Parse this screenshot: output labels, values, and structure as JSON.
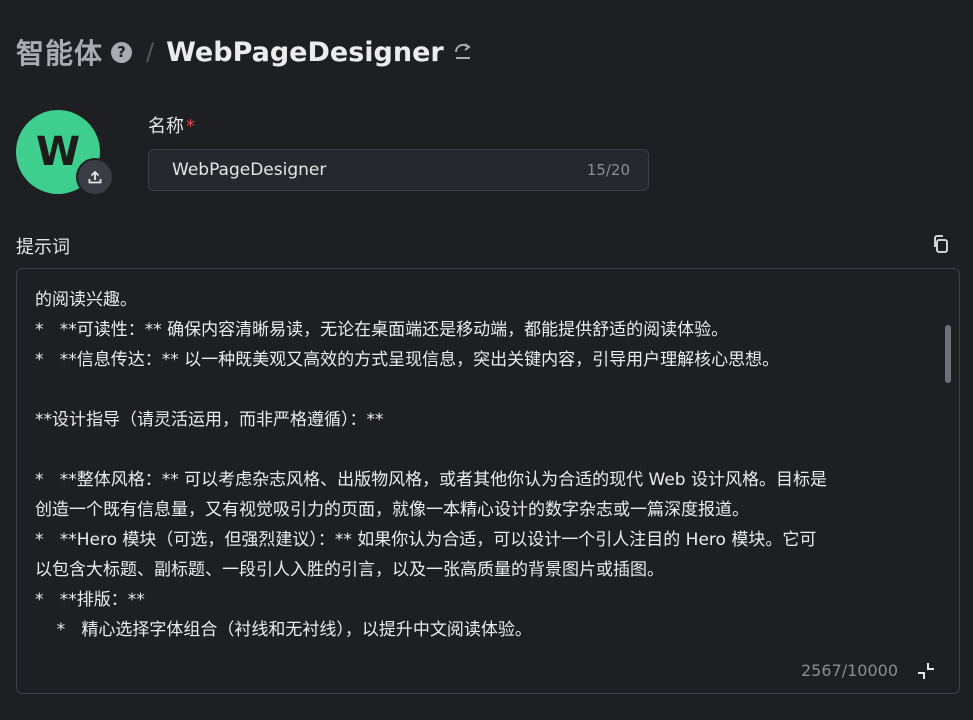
{
  "header": {
    "root_label": "智能体",
    "help_icon": "question-circle-icon",
    "separator": "/",
    "agent_name": "WebPageDesigner",
    "swap_icon": "swap-icon"
  },
  "avatar": {
    "letter": "W",
    "bg_color": "#3ecf8e",
    "upload_icon": "upload-icon"
  },
  "name_field": {
    "label": "名称",
    "required_mark": "*",
    "value": "WebPageDesigner",
    "counter": "15/20"
  },
  "prompt_field": {
    "label": "提示词",
    "copy_icon": "copy-icon",
    "lines": [
      "的阅读兴趣。",
      "*   **可读性：** 确保内容清晰易读，无论在桌面端还是移动端，都能提供舒适的阅读体验。",
      "*   **信息传达：** 以一种既美观又高效的方式呈现信息，突出关键内容，引导用户理解核心思想。",
      "",
      "**设计指导（请灵活运用，而非严格遵循）：**",
      "",
      "*   **整体风格：** 可以考虑杂志风格、出版物风格，或者其他你认为合适的现代 Web 设计风格。目标是",
      "创造一个既有信息量，又有视觉吸引力的页面，就像一本精心设计的数字杂志或一篇深度报道。",
      "*   **Hero 模块（可选，但强烈建议）：** 如果你认为合适，可以设计一个引人注目的 Hero 模块。它可",
      "以包含大标题、副标题、一段引人入胜的引言，以及一张高质量的背景图片或插图。",
      "*   **排版：**",
      "    *   精心选择字体组合（衬线和无衬线），以提升中文阅读体验。"
    ],
    "counter": "2567/10000",
    "collapse_icon": "collapse-icon"
  }
}
